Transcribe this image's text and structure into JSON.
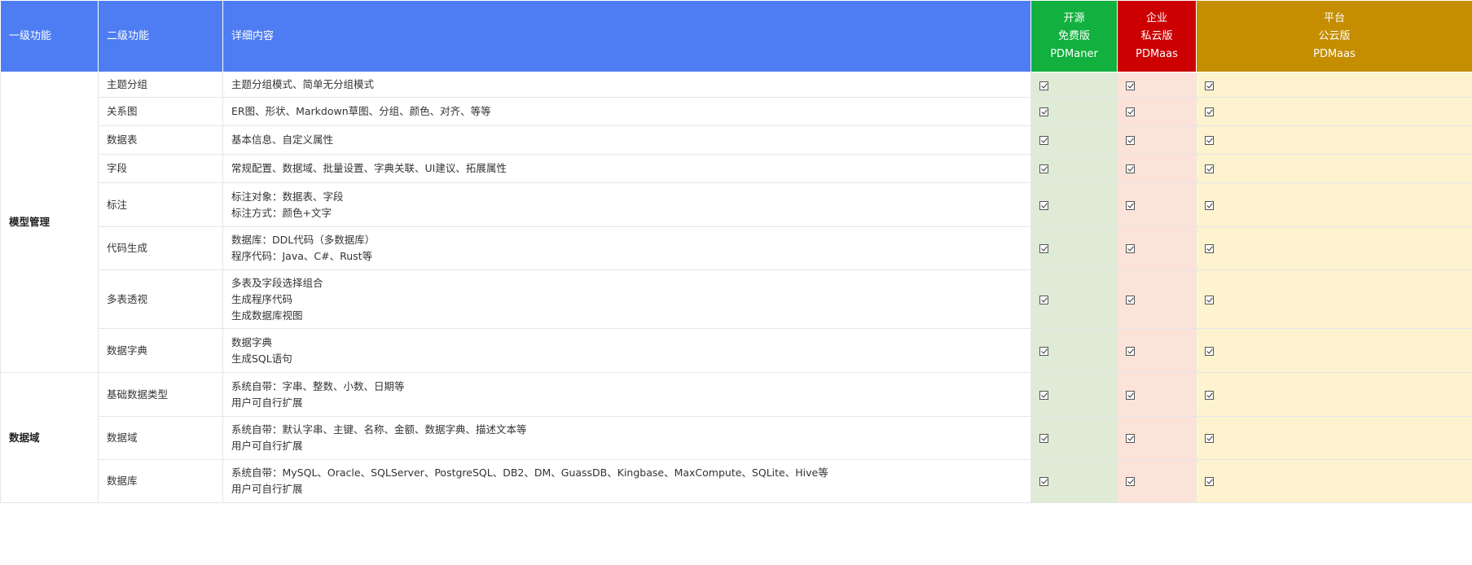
{
  "header": {
    "col_level1": "一级功能",
    "col_level2": "二级功能",
    "col_detail": "详细内容",
    "plans": [
      {
        "key": "free",
        "lines": [
          "开源",
          "免费版",
          "PDManer"
        ],
        "color": "#12b03e"
      },
      {
        "key": "ent",
        "lines": [
          "企业",
          "私云版",
          "PDMaas"
        ],
        "color": "#cc0000"
      },
      {
        "key": "cloud",
        "lines": [
          "平台",
          "公云版",
          "PDMaas"
        ],
        "color": "#c58d00"
      }
    ]
  },
  "groups": [
    {
      "name": "模型管理",
      "rows": [
        {
          "feature": "主题分组",
          "details": [
            "主题分组模式、简单无分组模式"
          ],
          "height": 31
        },
        {
          "feature": "关系图",
          "details": [
            "ER图、形状、Markdown草图、分组、颜色、对齐、等等"
          ],
          "height": 35
        },
        {
          "feature": "数据表",
          "details": [
            "基本信息、自定义属性"
          ],
          "height": 35
        },
        {
          "feature": "字段",
          "details": [
            "常规配置、数据域、批量设置、字典关联、UI建议、拓展属性"
          ],
          "height": 35
        },
        {
          "feature": "标注",
          "details": [
            "标注对象：数据表、字段",
            "标注方式：颜色+文字"
          ],
          "height": 54
        },
        {
          "feature": "代码生成",
          "details": [
            "数据库：DDL代码（多数据库）",
            "程序代码：Java、C#、Rust等"
          ],
          "height": 53
        },
        {
          "feature": "多表透视",
          "details": [
            "多表及字段选择组合",
            "生成程序代码",
            "生成数据库视图"
          ],
          "height": 72
        },
        {
          "feature": "数据字典",
          "details": [
            "数据字典",
            "生成SQL语句"
          ],
          "height": 54
        }
      ]
    },
    {
      "name": "数据域",
      "rows": [
        {
          "feature": "基础数据类型",
          "details": [
            "系统自带：字串、整数、小数、日期等",
            "用户可自行扩展"
          ],
          "height": 54
        },
        {
          "feature": "数据域",
          "details": [
            "系统自带：默认字串、主键、名称、金额、数据字典、描述文本等",
            "用户可自行扩展"
          ],
          "height": 53
        },
        {
          "feature": "数据库",
          "details": [
            "系统自带：MySQL、Oracle、SQLServer、PostgreSQL、DB2、DM、GuassDB、Kingbase、MaxCompute、SQLite、Hive等",
            "用户可自行扩展"
          ],
          "height": 53
        }
      ]
    }
  ],
  "check_icon": "checkbox-checked-icon"
}
